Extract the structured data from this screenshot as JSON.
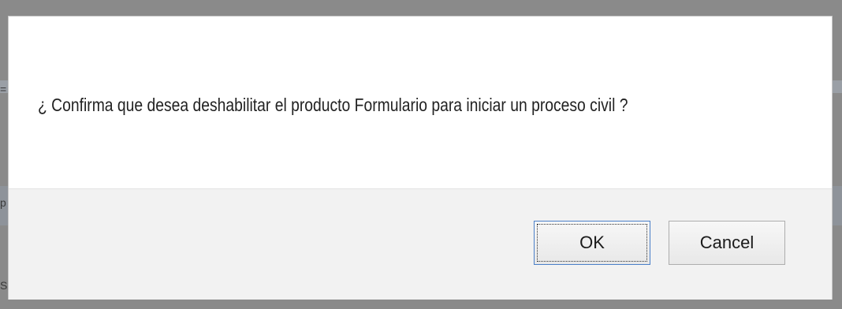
{
  "dialog": {
    "message": "¿ Confirma que desea deshabilitar el producto Formulario para iniciar un proceso civil ?",
    "buttons": {
      "ok_label": "OK",
      "cancel_label": "Cancel"
    }
  },
  "backdrop": {
    "edge_glyphs": [
      "=",
      "p",
      "S"
    ]
  },
  "colors": {
    "overlay": "#8a8a8a",
    "dialog_body": "#ffffff",
    "dialog_footer": "#f2f2f2",
    "ok_focus_border": "#4a7fc8"
  }
}
